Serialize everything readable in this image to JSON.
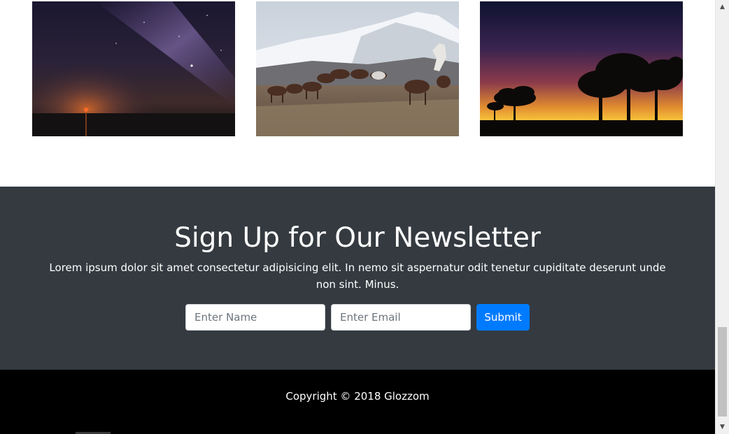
{
  "gallery": {
    "photos": [
      {
        "icon": "night-sky-milky-way-image"
      },
      {
        "icon": "wild-horses-mountains-image"
      },
      {
        "icon": "sunset-trees-silhouette-image"
      }
    ]
  },
  "newsletter": {
    "title": "Sign Up for Our Newsletter",
    "description": "Lorem ipsum dolor sit amet consectetur adipisicing elit. In nemo sit aspernatur odit tenetur cupiditate deserunt unde non sint. Minus.",
    "name_placeholder": "Enter Name",
    "email_placeholder": "Enter Email",
    "submit_label": "Submit",
    "background": "#343a40",
    "button_color": "#007bff"
  },
  "footer": {
    "copyright": "Copyright © 2018 Glozzom",
    "background": "#000000"
  },
  "scrollbar": {
    "up_icon": "▲",
    "down_icon": "▼"
  }
}
